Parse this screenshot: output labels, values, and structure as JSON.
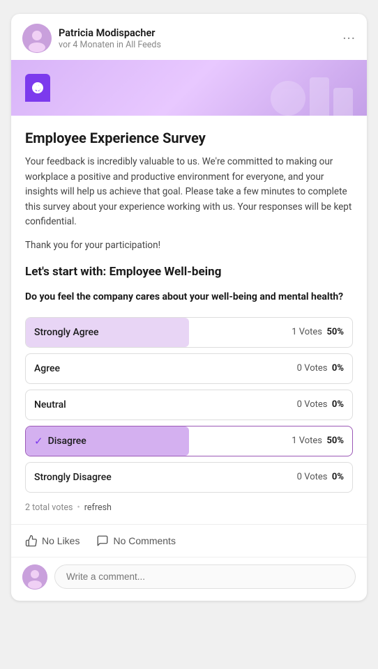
{
  "header": {
    "author": "Patricia Modispacher",
    "meta": "vor 4 Monaten in All Feeds",
    "more_label": "···"
  },
  "survey": {
    "title": "Employee Experience Survey",
    "description": "Your feedback is incredibly valuable to us. We're committed to making our workplace a positive and productive environment for everyone, and your insights will help us achieve that goal. Please take a few minutes to complete this survey about your experience working with us. Your responses will be kept confidential.",
    "thanks": "Thank you for your participation!",
    "section_title": "Let's start with: Employee Well-being",
    "question": "Do you feel the company cares about your well-being and mental health?",
    "options": [
      {
        "label": "Strongly Agree",
        "votes": 1,
        "votes_label": "1 Votes",
        "pct": "50%",
        "bar_pct": 50,
        "selected": false,
        "checked": false
      },
      {
        "label": "Agree",
        "votes": 0,
        "votes_label": "0 Votes",
        "pct": "0%",
        "bar_pct": 0,
        "selected": false,
        "checked": false
      },
      {
        "label": "Neutral",
        "votes": 0,
        "votes_label": "0 Votes",
        "pct": "0%",
        "bar_pct": 0,
        "selected": false,
        "checked": false
      },
      {
        "label": "Disagree",
        "votes": 1,
        "votes_label": "1 Votes",
        "pct": "50%",
        "bar_pct": 50,
        "selected": true,
        "checked": true
      },
      {
        "label": "Strongly Disagree",
        "votes": 0,
        "votes_label": "0 Votes",
        "pct": "0%",
        "bar_pct": 0,
        "selected": false,
        "checked": false
      }
    ],
    "total_votes_label": "2 total votes",
    "refresh_label": "refresh"
  },
  "actions": {
    "like_label": "No Likes",
    "comment_label": "No Comments"
  },
  "comment": {
    "placeholder": "Write a comment..."
  }
}
